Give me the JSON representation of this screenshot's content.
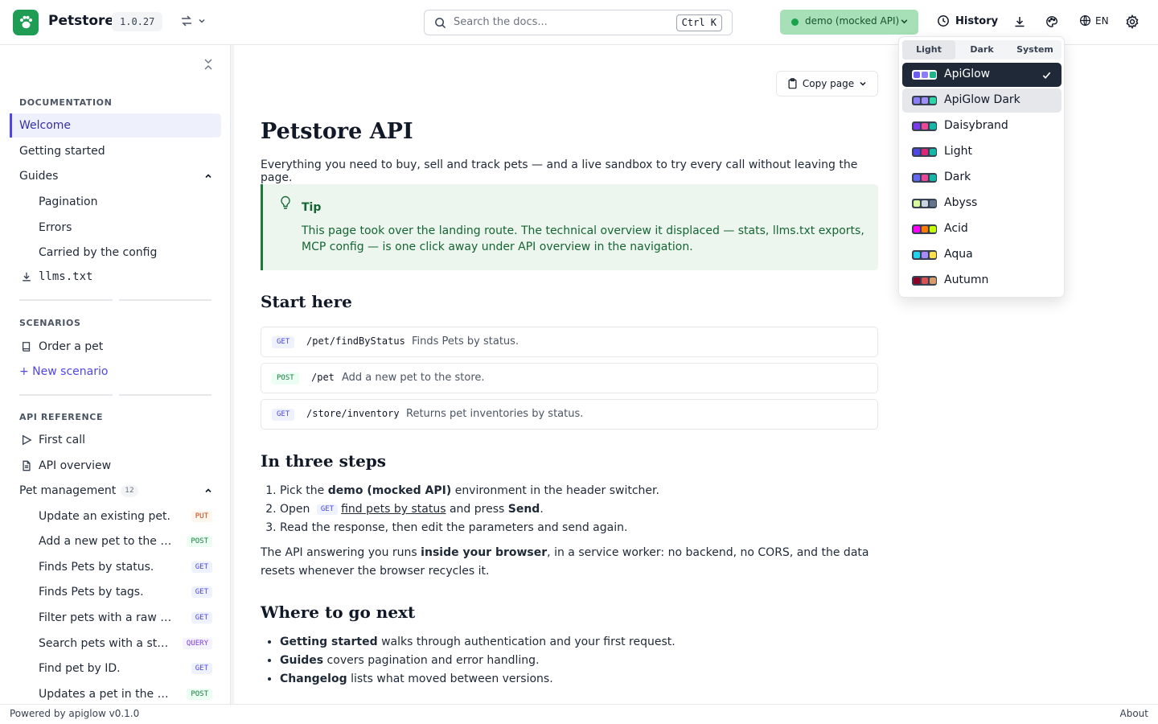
{
  "header": {
    "brand": "Petstore",
    "version": "1.0.27",
    "search_placeholder": "Search the docs...",
    "search_shortcut": "Ctrl K",
    "environment": "demo (mocked API)",
    "history": "History",
    "language": "EN",
    "colors": {
      "logo": "#1f9d55",
      "env_bg": "#a7e0b6",
      "env_dot": "#16a34a"
    }
  },
  "sidebar": {
    "documentation_label": "DOCUMENTATION",
    "docs": [
      {
        "label": "Welcome",
        "active": true
      },
      {
        "label": "Getting started"
      },
      {
        "label": "Guides"
      }
    ],
    "guides": [
      "Pagination",
      "Errors",
      "Carried by the config"
    ],
    "llms": "llms.txt",
    "scenarios_label": "SCENARIOS",
    "scenarios": [
      "Order a pet",
      "+ New scenario"
    ],
    "api_reference_label": "API REFERENCE",
    "api_items": [
      "First call",
      "API overview"
    ],
    "pet_group": {
      "label": "Pet management",
      "count": "12"
    },
    "endpoints": [
      {
        "label": "Update an existing pet.",
        "method": "PUT"
      },
      {
        "label": "Add a new pet to the st...",
        "method": "POST"
      },
      {
        "label": "Finds Pets by status.",
        "method": "GET"
      },
      {
        "label": "Finds Pets by tags.",
        "method": "GET"
      },
      {
        "label": "Filter pets with a raw qu...",
        "method": "GET"
      },
      {
        "label": "Search pets with a stru...",
        "method": "QUERY"
      },
      {
        "label": "Find pet by ID.",
        "method": "GET"
      },
      {
        "label": "Updates a pet in the st...",
        "method": "POST"
      }
    ]
  },
  "main": {
    "copy_page": "Copy page",
    "title": "Petstore API",
    "lead": "Everything you need to buy, sell and track pets — and a live sandbox to try every call without leaving the page.",
    "tip": {
      "title": "Tip",
      "body": "This page took over the landing route. The technical overview it displaced — stats, llms.txt exports, MCP config — is one click away under API overview in the navigation."
    },
    "start_here": "Start here",
    "cards": [
      {
        "method": "GET",
        "path": "/pet/findByStatus",
        "desc": "Finds Pets by status."
      },
      {
        "method": "POST",
        "path": "/pet",
        "desc": "Add a new pet to the store."
      },
      {
        "method": "GET",
        "path": "/store/inventory",
        "desc": "Returns pet inventories by status."
      }
    ],
    "steps_title": "In three steps",
    "steps": {
      "s1_a": "Pick the ",
      "s1_b": "demo (mocked API)",
      "s1_c": " environment in the header switcher.",
      "s2_a": "Open ",
      "s2_method": "GET",
      "s2_link": "find pets by status",
      "s2_c": " and press ",
      "s2_d": "Send",
      "s2_e": ".",
      "s3": "Read the response, then edit the parameters and send again."
    },
    "para": {
      "a": "The API answering you runs ",
      "b": "inside your browser",
      "c": ", in a service worker: no backend, no CORS, and the data resets whenever the browser recycles it."
    },
    "next_title": "Where to go next",
    "next": [
      {
        "bold": "Getting started",
        "rest": " walks through authentication and your first request."
      },
      {
        "bold": "Guides",
        "rest": " covers pagination and error handling."
      },
      {
        "bold": "Changelog",
        "rest": " lists what moved between versions."
      }
    ]
  },
  "footer": {
    "left": "Powered by apiglow v0.1.0",
    "right": "About"
  },
  "theme_menu": {
    "modes": [
      "Light",
      "Dark",
      "System"
    ],
    "active_mode": "Light",
    "themes": [
      {
        "name": "ApiGlow",
        "colors": [
          "#6d5cf6",
          "#8b7cf8",
          "#1fb48a"
        ],
        "selected": true
      },
      {
        "name": "ApiGlow Dark",
        "colors": [
          "#8b7cf8",
          "#a18ff9",
          "#2dd4a8"
        ],
        "hover": true
      },
      {
        "name": "Daisybrand",
        "colors": [
          "#7c3aed",
          "#ec4899",
          "#14b8a6"
        ]
      },
      {
        "name": "Light",
        "colors": [
          "#4f46e5",
          "#db2777",
          "#14b8a6"
        ]
      },
      {
        "name": "Dark",
        "colors": [
          "#6366f1",
          "#ec4899",
          "#14b8a6"
        ]
      },
      {
        "name": "Abyss",
        "colors": [
          "#d9f99d",
          "#cbd5e1",
          "#64748b"
        ]
      },
      {
        "name": "Acid",
        "colors": [
          "#ff00ff",
          "#ff7a00",
          "#c6ff00"
        ]
      },
      {
        "name": "Aqua",
        "colors": [
          "#22d3ee",
          "#a78bfa",
          "#fde047"
        ]
      },
      {
        "name": "Autumn",
        "colors": [
          "#8c0327",
          "#d85251",
          "#d59b6a"
        ]
      }
    ]
  }
}
